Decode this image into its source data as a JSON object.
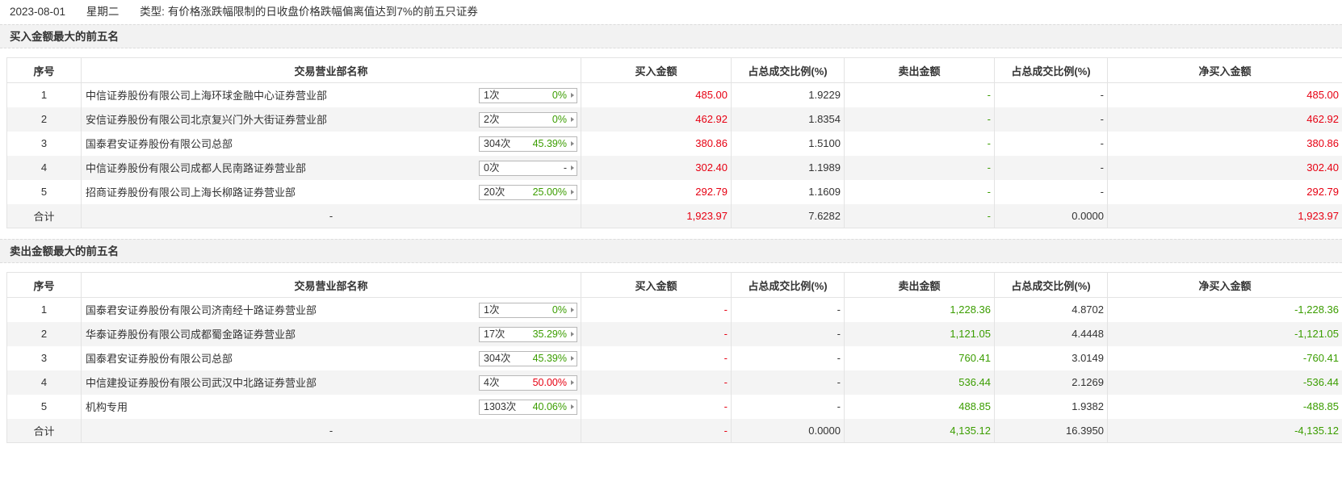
{
  "info": {
    "date": "2023-08-01",
    "weekday": "星期二",
    "type_label": "类型:",
    "type_value": "有价格涨跌幅限制的日收盘价格跌幅偏离值达到7%的前五只证券"
  },
  "headers": {
    "seq": "序号",
    "dept": "交易营业部名称",
    "buy": "买入金额",
    "buy_pct": "占总成交比例(%)",
    "sell": "卖出金额",
    "sell_pct": "占总成交比例(%)",
    "net": "净买入金额"
  },
  "buy_section": {
    "title": "买入金额最大的前五名",
    "rows": [
      {
        "seq": "1",
        "name": "中信证券股份有限公司上海环球金融中心证券营业部",
        "count": "1次",
        "rate": "0%",
        "rate_color": "#3b9d00",
        "buy": "485.00",
        "buy_pct": "1.9229",
        "sell": "-",
        "sell_pct": "-",
        "net": "485.00"
      },
      {
        "seq": "2",
        "name": "安信证券股份有限公司北京复兴门外大街证券营业部",
        "count": "2次",
        "rate": "0%",
        "rate_color": "#3b9d00",
        "buy": "462.92",
        "buy_pct": "1.8354",
        "sell": "-",
        "sell_pct": "-",
        "net": "462.92"
      },
      {
        "seq": "3",
        "name": "国泰君安证券股份有限公司总部",
        "count": "304次",
        "rate": "45.39%",
        "rate_color": "#3b9d00",
        "buy": "380.86",
        "buy_pct": "1.5100",
        "sell": "-",
        "sell_pct": "-",
        "net": "380.86"
      },
      {
        "seq": "4",
        "name": "中信证券股份有限公司成都人民南路证券营业部",
        "count": "0次",
        "rate": "-",
        "rate_color": "#333333",
        "buy": "302.40",
        "buy_pct": "1.1989",
        "sell": "-",
        "sell_pct": "-",
        "net": "302.40"
      },
      {
        "seq": "5",
        "name": "招商证券股份有限公司上海长柳路证券营业部",
        "count": "20次",
        "rate": "25.00%",
        "rate_color": "#3b9d00",
        "buy": "292.79",
        "buy_pct": "1.1609",
        "sell": "-",
        "sell_pct": "-",
        "net": "292.79"
      }
    ],
    "total": {
      "label": "合计",
      "name": "-",
      "buy": "1,923.97",
      "buy_pct": "7.6282",
      "sell": "-",
      "sell_pct": "0.0000",
      "net": "1,923.97"
    }
  },
  "sell_section": {
    "title": "卖出金额最大的前五名",
    "rows": [
      {
        "seq": "1",
        "name": "国泰君安证券股份有限公司济南经十路证券营业部",
        "count": "1次",
        "rate": "0%",
        "rate_color": "#3b9d00",
        "buy": "-",
        "buy_pct": "-",
        "sell": "1,228.36",
        "sell_pct": "4.8702",
        "net": "-1,228.36"
      },
      {
        "seq": "2",
        "name": "华泰证券股份有限公司成都蜀金路证券营业部",
        "count": "17次",
        "rate": "35.29%",
        "rate_color": "#3b9d00",
        "buy": "-",
        "buy_pct": "-",
        "sell": "1,121.05",
        "sell_pct": "4.4448",
        "net": "-1,121.05"
      },
      {
        "seq": "3",
        "name": "国泰君安证券股份有限公司总部",
        "count": "304次",
        "rate": "45.39%",
        "rate_color": "#3b9d00",
        "buy": "-",
        "buy_pct": "-",
        "sell": "760.41",
        "sell_pct": "3.0149",
        "net": "-760.41"
      },
      {
        "seq": "4",
        "name": "中信建投证券股份有限公司武汉中北路证券营业部",
        "count": "4次",
        "rate": "50.00%",
        "rate_color": "#e60012",
        "buy": "-",
        "buy_pct": "-",
        "sell": "536.44",
        "sell_pct": "2.1269",
        "net": "-536.44"
      },
      {
        "seq": "5",
        "name": "机构专用",
        "count": "1303次",
        "rate": "40.06%",
        "rate_color": "#3b9d00",
        "buy": "-",
        "buy_pct": "-",
        "sell": "488.85",
        "sell_pct": "1.9382",
        "net": "-488.85"
      }
    ],
    "total": {
      "label": "合计",
      "name": "-",
      "buy": "-",
      "buy_pct": "0.0000",
      "sell": "4,135.12",
      "sell_pct": "16.3950",
      "net": "-4,135.12"
    }
  }
}
